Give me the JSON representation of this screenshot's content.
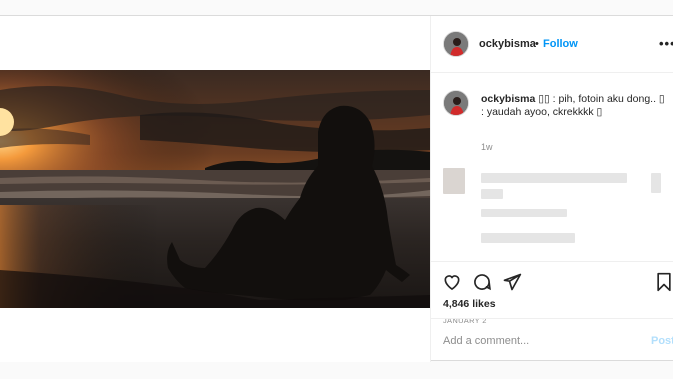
{
  "author": {
    "username": "ockybisma",
    "follow_label": "Follow",
    "separator": "•",
    "more_label": "•••"
  },
  "caption": {
    "username": "ockybisma",
    "text": "▯▯ : pih, fotoin aku dong.. ▯ : yaudah ayoo, ckrekkkk ▯",
    "time": "1w"
  },
  "actions": {
    "likes": "4,846 likes",
    "date": "JANUARY 2"
  },
  "comment_box": {
    "placeholder": "Add a comment...",
    "post_label": "Post"
  },
  "colors": {
    "link_blue": "#0095f6",
    "post_disabled": "#b2dffc",
    "border": "#dbdbdb"
  },
  "icons": [
    "heart-icon",
    "comment-icon",
    "share-icon",
    "bookmark-icon",
    "more-icon"
  ]
}
